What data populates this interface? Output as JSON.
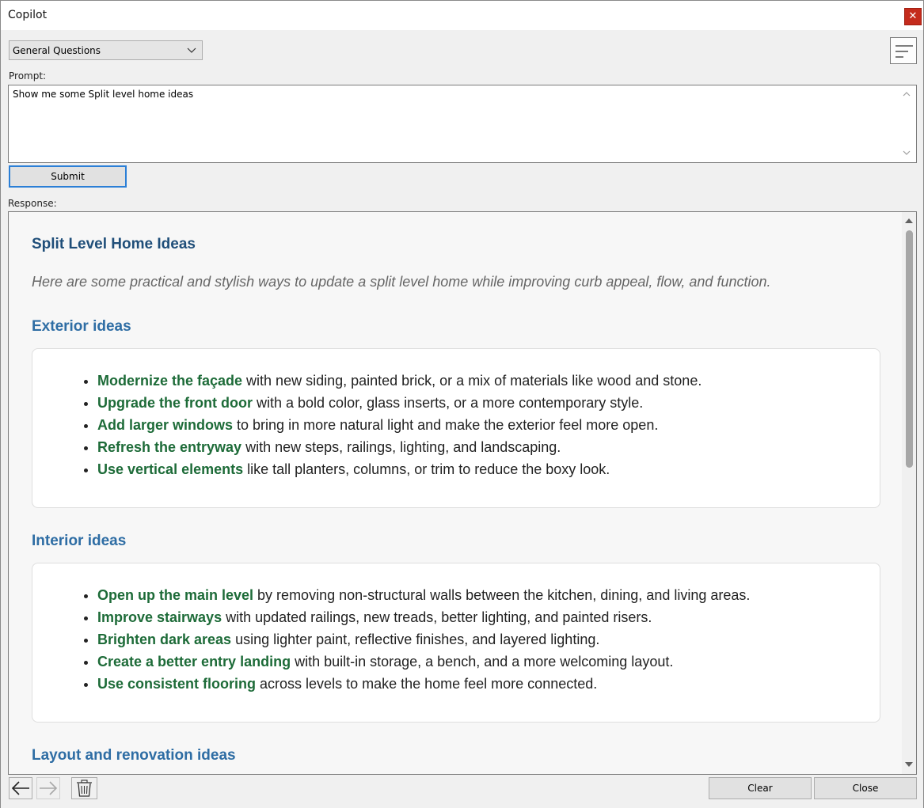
{
  "window": {
    "title": "Copilot",
    "close_glyph": "✕"
  },
  "toolbar": {
    "category_selected": "General Questions",
    "menu_icon": "hamburger-lines-icon"
  },
  "prompt": {
    "label": "Prompt:",
    "value": "Show me some Split level home ideas",
    "submit_label": "Submit"
  },
  "response": {
    "label": "Response:",
    "title": "Split Level Home Ideas",
    "intro": "Here are some practical and stylish ways to update a split level home while improving curb appeal, flow, and function.",
    "sections": [
      {
        "heading": "Exterior ideas",
        "items": [
          {
            "lead": "Modernize the façade",
            "rest": " with new siding, painted brick, or a mix of materials like wood and stone."
          },
          {
            "lead": "Upgrade the front door",
            "rest": " with a bold color, glass inserts, or a more contemporary style."
          },
          {
            "lead": "Add larger windows",
            "rest": " to bring in more natural light and make the exterior feel more open."
          },
          {
            "lead": "Refresh the entryway",
            "rest": " with new steps, railings, lighting, and landscaping."
          },
          {
            "lead": "Use vertical elements",
            "rest": " like tall planters, columns, or trim to reduce the boxy look."
          }
        ]
      },
      {
        "heading": "Interior ideas",
        "items": [
          {
            "lead": "Open up the main level",
            "rest": " by removing non-structural walls between the kitchen, dining, and living areas."
          },
          {
            "lead": "Improve stairways",
            "rest": " with updated railings, new treads, better lighting, and painted risers."
          },
          {
            "lead": "Brighten dark areas",
            "rest": " using lighter paint, reflective finishes, and layered lighting."
          },
          {
            "lead": "Create a better entry landing",
            "rest": " with built-in storage, a bench, and a more welcoming layout."
          },
          {
            "lead": "Use consistent flooring",
            "rest": " across levels to make the home feel more connected."
          }
        ]
      },
      {
        "heading": "Layout and renovation ideas",
        "items": []
      }
    ]
  },
  "footer": {
    "back_icon": "arrow-left-icon",
    "forward_icon": "arrow-right-icon",
    "delete_icon": "trash-icon",
    "clear_label": "Clear",
    "close_label": "Close"
  },
  "colors": {
    "title_blue": "#1f4e79",
    "section_blue": "#2e6da4",
    "lead_green": "#1d6b38",
    "close_red": "#c42b1c",
    "focus_blue": "#2b7fd6"
  }
}
